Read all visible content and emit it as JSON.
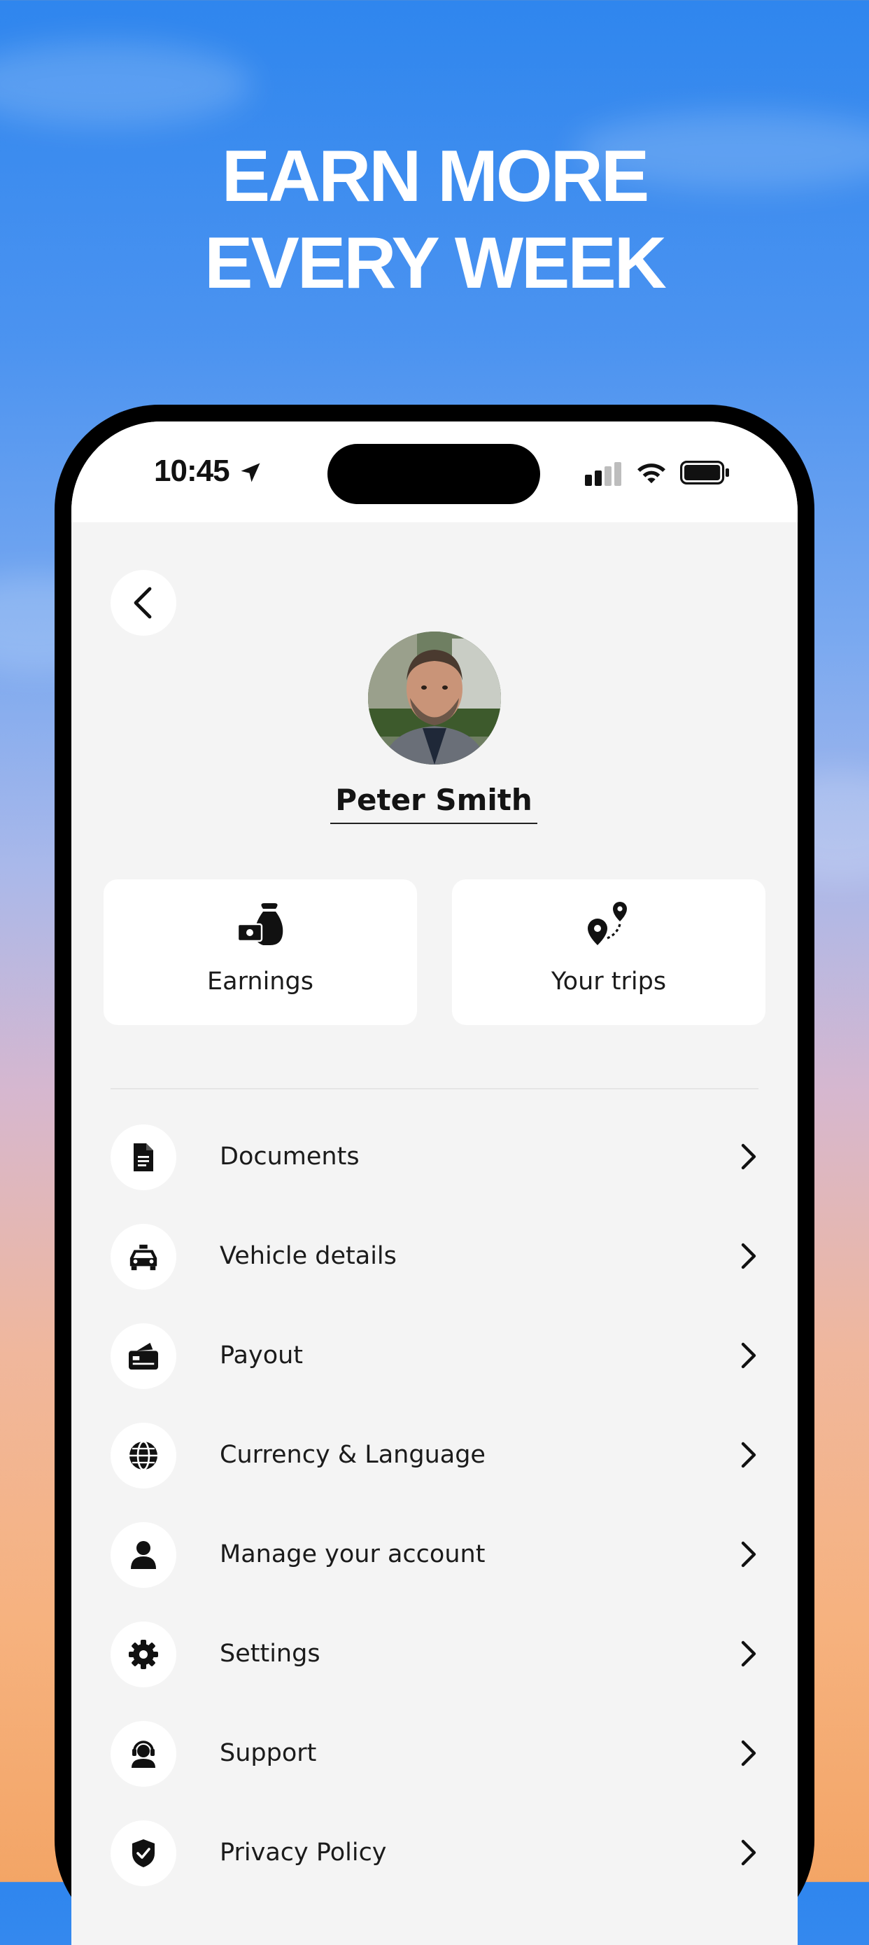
{
  "headline": {
    "line1": "EARN MORE",
    "line2": "EVERY WEEK"
  },
  "statusbar": {
    "time": "10:45"
  },
  "profile": {
    "name": "Peter Smith"
  },
  "cards": [
    {
      "label": "Earnings",
      "icon": "money-bag-icon"
    },
    {
      "label": "Your trips",
      "icon": "route-pin-icon"
    }
  ],
  "menu": [
    {
      "label": "Documents",
      "icon": "document-icon"
    },
    {
      "label": "Vehicle details",
      "icon": "taxi-icon"
    },
    {
      "label": "Payout",
      "icon": "wallet-card-icon"
    },
    {
      "label": "Currency & Language",
      "icon": "globe-icon"
    },
    {
      "label": "Manage your account",
      "icon": "person-icon"
    },
    {
      "label": "Settings",
      "icon": "gear-icon"
    },
    {
      "label": "Support",
      "icon": "headset-icon"
    },
    {
      "label": "Privacy Policy",
      "icon": "shield-check-icon"
    }
  ]
}
